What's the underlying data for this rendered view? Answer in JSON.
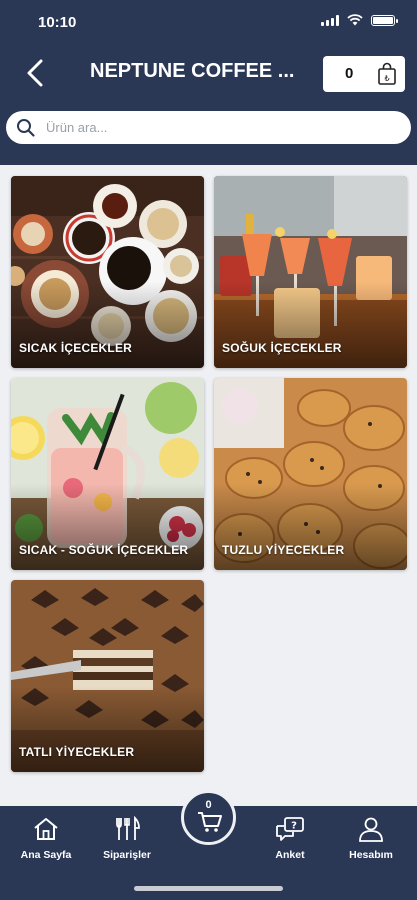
{
  "status": {
    "time": "10:10"
  },
  "header": {
    "title": "NEPTUNE COFFEE ...",
    "cart_count": "0"
  },
  "search": {
    "placeholder": "Ürün ara..."
  },
  "categories": [
    {
      "label": "SICAK İÇECEKLER"
    },
    {
      "label": "SOĞUK İÇECEKLER"
    },
    {
      "label": "SICAK - SOĞUK İÇECEKLER"
    },
    {
      "label": "TUZLU YİYECEKLER"
    },
    {
      "label": "TATLI YİYECEKLER"
    }
  ],
  "nav": {
    "home": "Ana Sayfa",
    "orders": "Siparişler",
    "cart_count": "0",
    "survey": "Anket",
    "account": "Hesabım"
  },
  "colors": {
    "primary": "#2a3856",
    "background": "#eef0f3"
  }
}
